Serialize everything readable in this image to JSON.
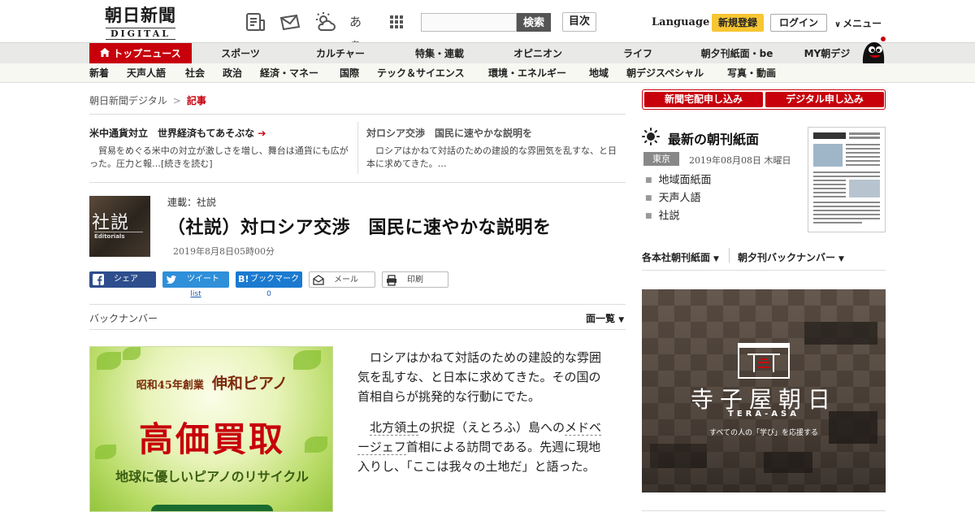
{
  "header": {
    "logo_main": "朝日新聞",
    "logo_sub": "DIGITAL",
    "search_placeholder": "",
    "search_button": "検索",
    "contents_button": "目次",
    "language": "Language",
    "register": "新規登録",
    "login": "ログイン",
    "menu": "メニュー",
    "font_size_label": "あぁ"
  },
  "nav_primary": [
    {
      "label": "トップニュース",
      "active": true
    },
    {
      "label": "スポーツ"
    },
    {
      "label": "カルチャー"
    },
    {
      "label": "特集・連載"
    },
    {
      "label": "オピニオン"
    },
    {
      "label": "ライフ"
    },
    {
      "label": "朝夕刊紙面・be"
    },
    {
      "label": "MY朝デジ"
    }
  ],
  "nav_secondary": [
    "新着",
    "天声人語",
    "社会",
    "政治",
    "経済・マネー",
    "国際",
    "テック＆サイエンス",
    "環境・エネルギー",
    "地域",
    "朝デジスペシャル",
    "写真・動画"
  ],
  "breadcrumb": {
    "root": "朝日新聞デジタル",
    "separator": ">",
    "current": "記事"
  },
  "related": [
    {
      "title": "米中通貨対立　世界経済もてあそぶな",
      "body": "貿易をめぐる米中の対立が激しさを増し、舞台は通貨にも広がった。圧力と報…",
      "more": "[続きを読む]"
    },
    {
      "title": "対ロシア交渉　国民に速やかな説明を",
      "body": "ロシアはかねて対話のための建設的な雰囲気を乱すな、と日本に求めてきた。…"
    }
  ],
  "article": {
    "thumb_kanji": "社説",
    "thumb_en": "Editorials",
    "series": "連載：社説",
    "headline": "（社説）対ロシア交渉　国民に速やかな説明を",
    "date": "2019年8月8日05時00分",
    "paragraph1": "ロシアはかねて対話のための建設的な雰囲気を乱すな、と日本に求めてきた。その国の首相自らが挑発的な行動にでた。",
    "p2_link1": "北方領土",
    "p2_text1": "の択捉（えとろふ）島への",
    "p2_link2": "メドベージェフ",
    "p2_text2": "首相による訪問である。先週に現地入りし、「ここは我々の土地だ」と語った。"
  },
  "share": {
    "facebook": "シェア",
    "twitter": "ツイート",
    "twitter_count": "list",
    "hatena": "ブックマーク",
    "hatena_count": "0",
    "mail": "メール",
    "print": "印刷"
  },
  "backnumber": {
    "label": "バックナンバー",
    "menu": "面一覧"
  },
  "ad": {
    "since": "昭和45年創業",
    "brand": "伸和ピアノ",
    "main": "高価買取",
    "sub": "地球に優しいピアノのリサイクル"
  },
  "sidebar": {
    "subscribe_paper": "新聞宅配申し込み",
    "subscribe_digital": "デジタル申し込み",
    "morning_title": "最新の朝刊紙面",
    "region": "東京",
    "morning_date": "2019年08月08日 木曜日",
    "links": [
      "地域面紙面",
      "天声人語",
      "社説"
    ],
    "regional_pages": "各本社朝刊紙面",
    "back_issues": "朝夕刊バックナンバー"
  },
  "tera": {
    "name": "寺子屋朝日",
    "en": "TERA-ASA",
    "tagline": "すべての人の「学び」を応援する"
  },
  "colors": {
    "brand_red": "#c7000b",
    "register_yellow": "#f7c633",
    "facebook": "#2d4d8d",
    "twitter": "#2f8fd9",
    "hatena": "#1b7ad0"
  }
}
